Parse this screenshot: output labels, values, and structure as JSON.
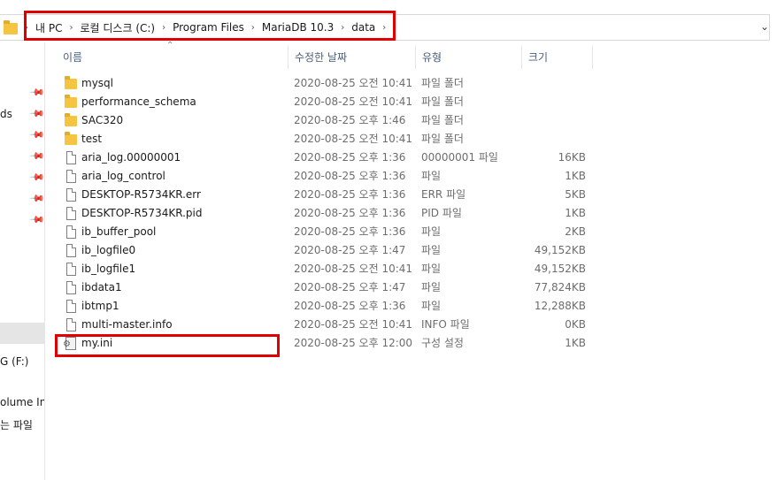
{
  "address": {
    "crumbs": [
      "내 PC",
      "로컬 디스크 (C:)",
      "Program Files",
      "MariaDB 10.3",
      "data"
    ],
    "expand_icon": "chevron-down-icon"
  },
  "sidebar": {
    "fragment_ds": "ds",
    "fragment_drive": "G (F:)",
    "fragment_volume": "olume Inf",
    "fragment_files": "는 파일"
  },
  "columns": {
    "name": "이름",
    "date": "수정한 날짜",
    "type": "유형",
    "size": "크기"
  },
  "files": [
    {
      "name": "mysql",
      "date": "2020-08-25 오전 10:41",
      "type": "파일 폴더",
      "size": "",
      "icon": "folder-icon"
    },
    {
      "name": "performance_schema",
      "date": "2020-08-25 오전 10:41",
      "type": "파일 폴더",
      "size": "",
      "icon": "folder-icon"
    },
    {
      "name": "SAC320",
      "date": "2020-08-25 오후 1:46",
      "type": "파일 폴더",
      "size": "",
      "icon": "folder-icon"
    },
    {
      "name": "test",
      "date": "2020-08-25 오전 10:41",
      "type": "파일 폴더",
      "size": "",
      "icon": "folder-icon"
    },
    {
      "name": "aria_log.00000001",
      "date": "2020-08-25 오후 1:36",
      "type": "00000001 파일",
      "size": "16KB",
      "icon": "file-icon"
    },
    {
      "name": "aria_log_control",
      "date": "2020-08-25 오후 1:36",
      "type": "파일",
      "size": "1KB",
      "icon": "file-icon"
    },
    {
      "name": "DESKTOP-R5734KR.err",
      "date": "2020-08-25 오후 1:36",
      "type": "ERR 파일",
      "size": "5KB",
      "icon": "file-icon"
    },
    {
      "name": "DESKTOP-R5734KR.pid",
      "date": "2020-08-25 오후 1:36",
      "type": "PID 파일",
      "size": "1KB",
      "icon": "file-icon"
    },
    {
      "name": "ib_buffer_pool",
      "date": "2020-08-25 오후 1:36",
      "type": "파일",
      "size": "2KB",
      "icon": "file-icon"
    },
    {
      "name": "ib_logfile0",
      "date": "2020-08-25 오후 1:47",
      "type": "파일",
      "size": "49,152KB",
      "icon": "file-icon"
    },
    {
      "name": "ib_logfile1",
      "date": "2020-08-25 오전 10:41",
      "type": "파일",
      "size": "49,152KB",
      "icon": "file-icon"
    },
    {
      "name": "ibdata1",
      "date": "2020-08-25 오후 1:47",
      "type": "파일",
      "size": "77,824KB",
      "icon": "file-icon"
    },
    {
      "name": "ibtmp1",
      "date": "2020-08-25 오후 1:36",
      "type": "파일",
      "size": "12,288KB",
      "icon": "file-icon"
    },
    {
      "name": "multi-master.info",
      "date": "2020-08-25 오전 10:41",
      "type": "INFO 파일",
      "size": "0KB",
      "icon": "file-icon"
    },
    {
      "name": "my.ini",
      "date": "2020-08-25 오후 12:00",
      "type": "구성 설정",
      "size": "1KB",
      "icon": "config-file-icon"
    }
  ],
  "colors": {
    "highlight": "#e00000",
    "folder": "#f5c542"
  }
}
